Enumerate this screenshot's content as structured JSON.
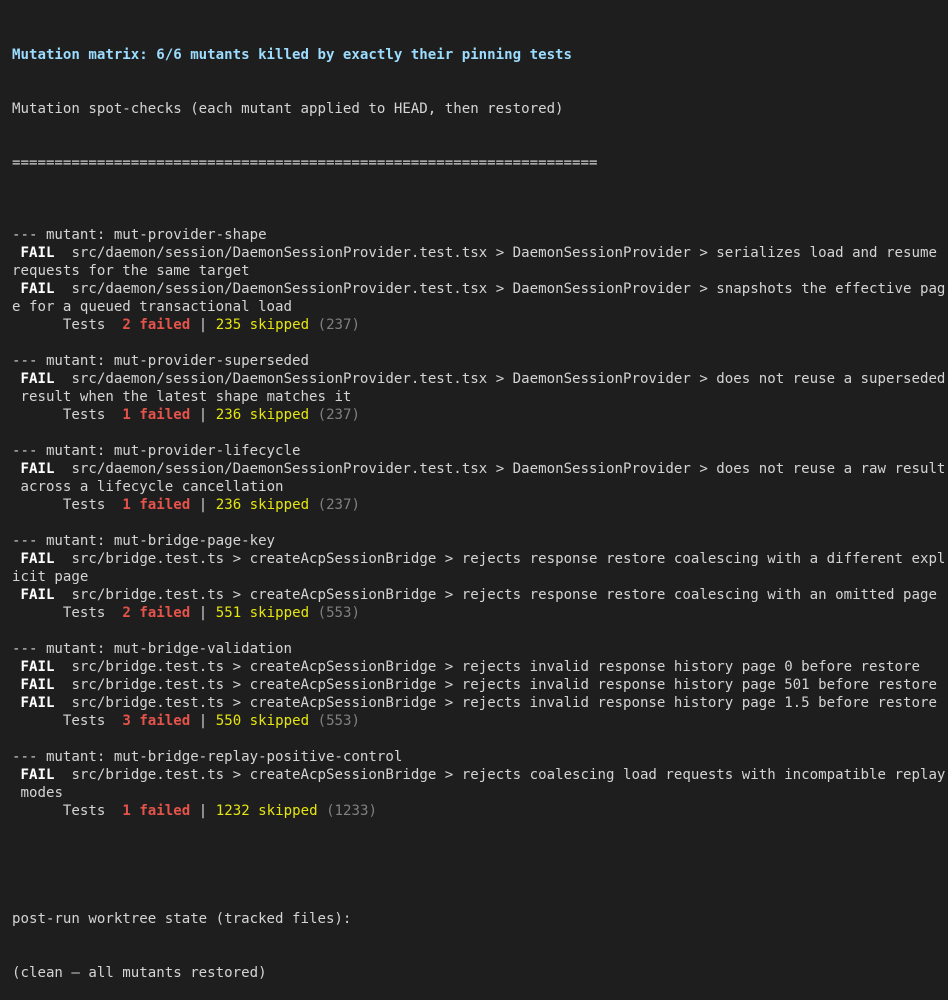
{
  "title": "Mutation matrix: 6/6 mutants killed by exactly their pinning tests",
  "subtitle": "Mutation spot-checks (each mutant applied to HEAD, then restored)",
  "rule": "=====================================================================",
  "fail_label": "FAIL",
  "tests_label": "Tests",
  "separator": "|",
  "mutants": [
    {
      "header": "--- mutant: mut-provider-shape",
      "fails": [
        {
          "lines": [
            "src/daemon/session/DaemonSessionProvider.test.tsx > DaemonSessionProvider > serializes load and resume",
            "requests for the same target"
          ],
          "wrap_indent": false
        },
        {
          "lines": [
            "src/daemon/session/DaemonSessionProvider.test.tsx > DaemonSessionProvider > snapshots the effective pag",
            "e for a queued transactional load"
          ],
          "wrap_indent": false
        }
      ],
      "failed": "2 failed",
      "skipped": "235 skipped",
      "total": "(237)"
    },
    {
      "header": "--- mutant: mut-provider-superseded",
      "fails": [
        {
          "lines": [
            "src/daemon/session/DaemonSessionProvider.test.tsx > DaemonSessionProvider > does not reuse a superseded",
            "result when the latest shape matches it"
          ],
          "wrap_indent": true
        }
      ],
      "failed": "1 failed",
      "skipped": "236 skipped",
      "total": "(237)"
    },
    {
      "header": "--- mutant: mut-provider-lifecycle",
      "fails": [
        {
          "lines": [
            "src/daemon/session/DaemonSessionProvider.test.tsx > DaemonSessionProvider > does not reuse a raw result",
            "across a lifecycle cancellation"
          ],
          "wrap_indent": true
        }
      ],
      "failed": "1 failed",
      "skipped": "236 skipped",
      "total": "(237)"
    },
    {
      "header": "--- mutant: mut-bridge-page-key",
      "fails": [
        {
          "lines": [
            "src/bridge.test.ts > createAcpSessionBridge > rejects response restore coalescing with a different expl",
            "icit page"
          ],
          "wrap_indent": false
        },
        {
          "lines": [
            "src/bridge.test.ts > createAcpSessionBridge > rejects response restore coalescing with an omitted page"
          ],
          "wrap_indent": false
        }
      ],
      "failed": "2 failed",
      "skipped": "551 skipped",
      "total": "(553)"
    },
    {
      "header": "--- mutant: mut-bridge-validation",
      "fails": [
        {
          "lines": [
            "src/bridge.test.ts > createAcpSessionBridge > rejects invalid response history page 0 before restore"
          ],
          "wrap_indent": false
        },
        {
          "lines": [
            "src/bridge.test.ts > createAcpSessionBridge > rejects invalid response history page 501 before restore"
          ],
          "wrap_indent": false
        },
        {
          "lines": [
            "src/bridge.test.ts > createAcpSessionBridge > rejects invalid response history page 1.5 before restore"
          ],
          "wrap_indent": false
        }
      ],
      "failed": "3 failed",
      "skipped": "550 skipped",
      "total": "(553)"
    },
    {
      "header": "--- mutant: mut-bridge-replay-positive-control",
      "fails": [
        {
          "lines": [
            "src/bridge.test.ts > createAcpSessionBridge > rejects coalescing load requests with incompatible replay",
            "modes"
          ],
          "wrap_indent": true
        }
      ],
      "failed": "1 failed",
      "skipped": "1232 skipped",
      "total": "(1233)"
    }
  ],
  "footer": {
    "line1": "post-run worktree state (tracked files):",
    "line2": "(clean — all mutants restored)"
  }
}
